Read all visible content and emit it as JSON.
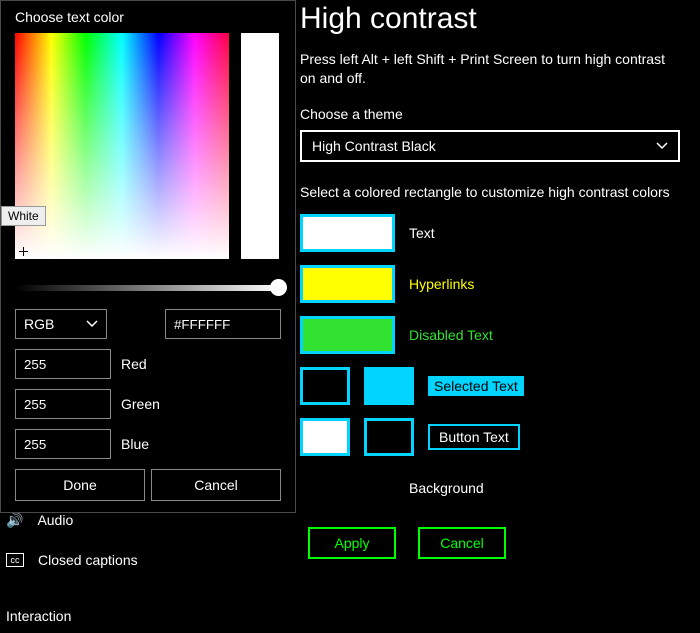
{
  "settings": {
    "heading": "High contrast",
    "description": "Press left Alt + left Shift + Print Screen to turn high contrast on and off.",
    "choose_theme_label": "Choose a theme",
    "theme_value": "High Contrast Black",
    "select_rect_label": "Select a colored rectangle to customize high contrast colors",
    "swatches": {
      "text": "Text",
      "hyperlinks": "Hyperlinks",
      "disabled": "Disabled Text",
      "selected": "Selected Text",
      "button": "Button Text",
      "background": "Background"
    },
    "apply": "Apply",
    "cancel": "Cancel"
  },
  "sidebar": {
    "audio": "Audio",
    "cc": "Closed captions",
    "interaction_header": "Interaction"
  },
  "picker": {
    "title": "Choose text color",
    "tooltip": "White",
    "mode": "RGB",
    "hex": "#FFFFFF",
    "r": "255",
    "g": "255",
    "b": "255",
    "r_label": "Red",
    "g_label": "Green",
    "b_label": "Blue",
    "done": "Done",
    "cancel": "Cancel"
  }
}
